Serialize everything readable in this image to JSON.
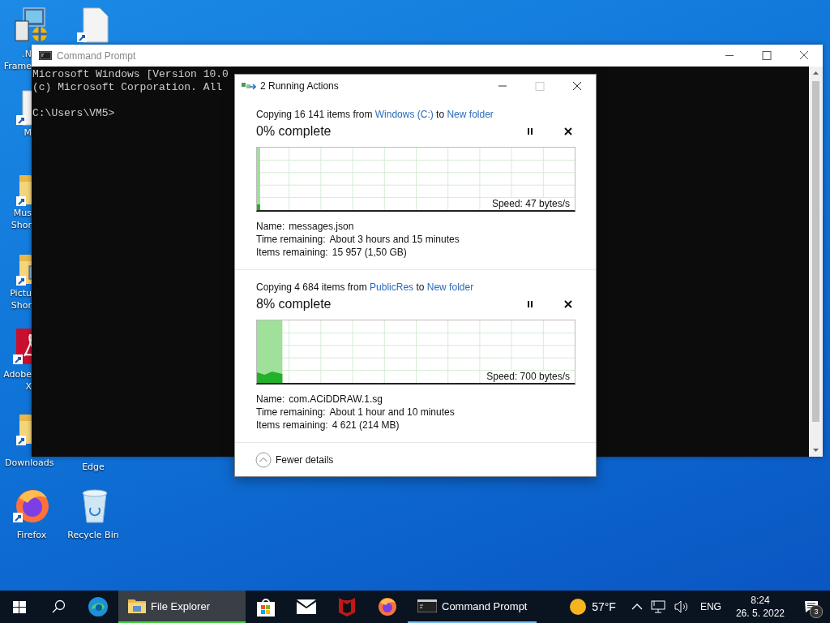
{
  "desktop_icons": [
    {
      "kind": "installer",
      "label_lines": [
        ".N",
        "Frame"
      ]
    },
    {
      "kind": "file"
    },
    {
      "kind": "file",
      "label_lines": [
        "M"
      ]
    },
    {
      "kind": "folder",
      "label_lines": [
        "Mus",
        "Shor"
      ]
    },
    {
      "kind": "pictures",
      "label_lines": [
        "Pictu",
        "Shor"
      ]
    },
    {
      "kind": "pdf",
      "label_lines": [
        "Adobe",
        "X"
      ]
    },
    {
      "kind": "folder",
      "label_lines": [
        "Downloads"
      ]
    },
    {
      "kind": "none",
      "label_lines": [
        "Edge"
      ]
    },
    {
      "kind": "firefox",
      "label_lines": [
        "Firefox"
      ]
    },
    {
      "kind": "recycle",
      "label_lines": [
        "Recycle Bin"
      ]
    }
  ],
  "console_window": {
    "title": "Command Prompt",
    "banner_lines": [
      "Microsoft Windows [Version 10.0",
      "(c) Microsoft Corporation. All"
    ],
    "prompt": "C:\\Users\\VM5>"
  },
  "copy_dialog": {
    "title": "2 Running Actions",
    "operations": [
      {
        "prefix": "Copying 16 141 items from",
        "source": "Windows (C:)",
        "joiner": "to",
        "destination": "New folder",
        "percent": "0% complete",
        "level": 0.01,
        "speed": "Speed: 47 bytes/s",
        "details": [
          {
            "label": "Name:",
            "value": "messages.json"
          },
          {
            "label": "Time remaining:",
            "value": "About 3 hours and 15 minutes"
          },
          {
            "label": "Items remaining:",
            "value": "15 957 (1,50 GB)"
          }
        ]
      },
      {
        "prefix": "Copying 4 684 items from",
        "source": "PublicRes",
        "joiner": "to",
        "destination": "New folder",
        "percent": "8% complete",
        "level": 0.08,
        "speed": "Speed: 700 bytes/s",
        "details": [
          {
            "label": "Name:",
            "value": "com.ACiDDRAW.1.sg"
          },
          {
            "label": "Time remaining:",
            "value": "About 1 hour and 10 minutes"
          },
          {
            "label": "Items remaining:",
            "value": "4 621 (214 MB)"
          }
        ]
      }
    ],
    "footer_button": "Fewer details"
  },
  "taskbar": {
    "apps": [
      {
        "kind": "edge",
        "selected": false,
        "running": false
      },
      {
        "kind": "explorer",
        "label": "File Explorer",
        "selected": true,
        "running": true
      },
      {
        "kind": "store",
        "selected": false,
        "running": false
      },
      {
        "kind": "mail",
        "selected": false,
        "running": false
      },
      {
        "kind": "shield",
        "selected": false,
        "running": false
      },
      {
        "kind": "firefox",
        "selected": false,
        "running": false
      },
      {
        "kind": "console",
        "label": "Command Prompt",
        "selected": false,
        "running": true
      }
    ],
    "weather": "57°F",
    "language": "ENG",
    "time": "8:24",
    "date": "26. 5. 2022",
    "notification_count": "3"
  }
}
